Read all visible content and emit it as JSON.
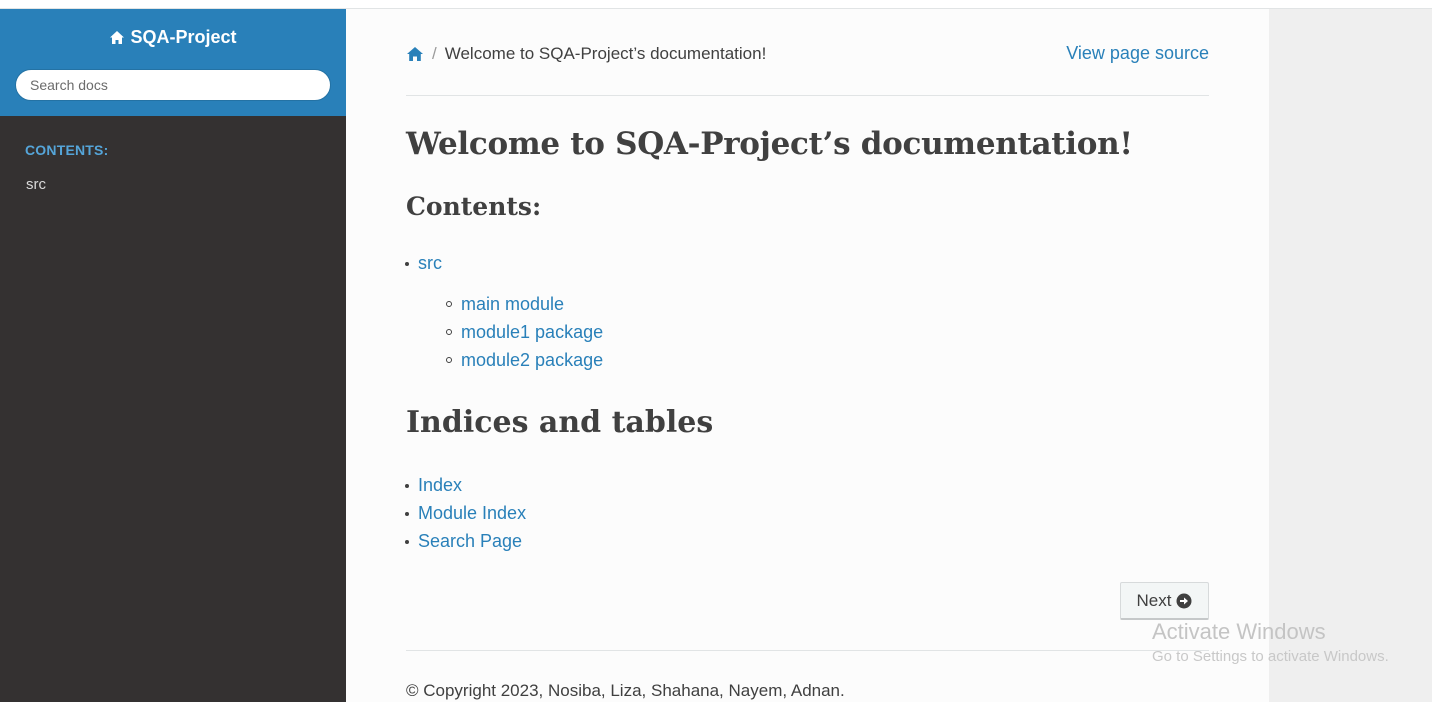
{
  "sidebar": {
    "project_name": "SQA-Project",
    "search_placeholder": "Search docs",
    "caption": "CONTENTS:",
    "items": [
      {
        "label": "src"
      }
    ],
    "colors": {
      "header_bg": "#2980b9",
      "body_bg": "#343131",
      "caption": "#55a5d9"
    }
  },
  "breadcrumb": {
    "current": "Welcome to SQA-Project’s documentation!",
    "view_source": "View page source"
  },
  "main": {
    "title": "Welcome to SQA-Project’s documentation!",
    "contents_heading": "Contents:",
    "toc": [
      {
        "label": "src",
        "children": [
          {
            "label": "main module"
          },
          {
            "label": "module1 package"
          },
          {
            "label": "module2 package"
          }
        ]
      }
    ],
    "indices_heading": "Indices and tables",
    "indices": [
      {
        "label": "Index"
      },
      {
        "label": "Module Index"
      },
      {
        "label": "Search Page"
      }
    ],
    "next_label": "Next"
  },
  "footer": {
    "copyright": "© Copyright 2023, Nosiba, Liza, Shahana, Nayem, Adnan."
  },
  "watermark": {
    "title": "Activate Windows",
    "subtitle": "Go to Settings to activate Windows."
  },
  "icons": {
    "sidebar_home": "home-icon",
    "breadcrumb_home": "home-icon",
    "next": "arrow-circle-right-icon"
  },
  "colors": {
    "link": "#2980b9",
    "text": "#404040",
    "content_bg": "#fcfcfc"
  }
}
